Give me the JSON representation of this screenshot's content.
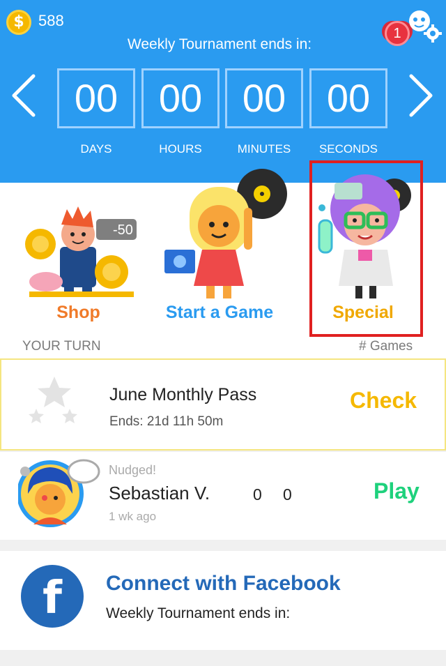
{
  "header": {
    "coins": "588",
    "coin_symbol": "$",
    "notification_count": "1",
    "tournament_title": "Weekly Tournament ends in:",
    "countdown": [
      {
        "value": "00",
        "label": "DAYS"
      },
      {
        "value": "00",
        "label": "HOURS"
      },
      {
        "value": "00",
        "label": "MINUTES"
      },
      {
        "value": "00",
        "label": "SECONDS"
      }
    ]
  },
  "tiles": {
    "shop": {
      "label": "Shop",
      "price_tag": "-50"
    },
    "start": {
      "label": "Start a Game"
    },
    "special": {
      "label": "Special"
    }
  },
  "sections": {
    "your_turn": "YOUR TURN",
    "games": "# Games"
  },
  "pass": {
    "title": "June Monthly Pass",
    "subtitle": "Ends: 21d 11h 50m",
    "action": "Check"
  },
  "match": {
    "status": "Nudged!",
    "opponent": "Sebastian V.",
    "score_me": "0",
    "score_opp": "0",
    "time": "1 wk ago",
    "action": "Play"
  },
  "facebook": {
    "letter": "f",
    "title": "Connect with Facebook",
    "subtitle": "Weekly Tournament ends in:"
  },
  "colors": {
    "header_bg": "#2a9bf0",
    "shop": "#f07b2a",
    "start": "#2a9bf0",
    "special": "#f0a800",
    "check": "#f5b800",
    "play": "#1ed17c",
    "facebook": "#2469b8",
    "highlight": "#e02020"
  }
}
